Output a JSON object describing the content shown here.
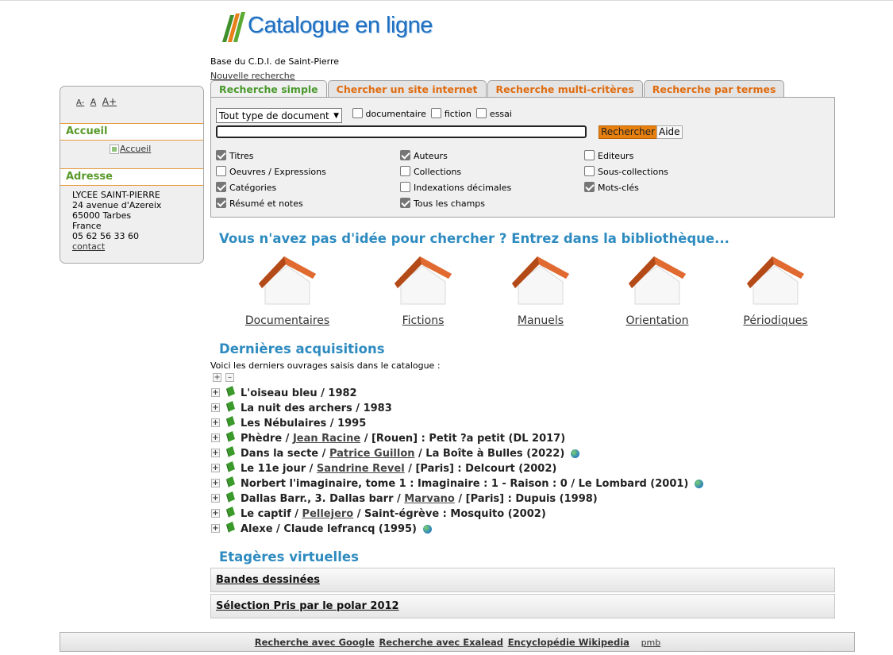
{
  "header": {
    "logo_text": "Catalogue en ligne",
    "base_name": "Base du C.D.I. de Saint-Pierre",
    "new_search": "Nouvelle recherche"
  },
  "sidebar": {
    "font_sizes": [
      "A-",
      "A",
      "A+"
    ],
    "accueil_title": "Accueil",
    "accueil_img_alt": "Accueil",
    "adresse_title": "Adresse",
    "address_lines": [
      "LYCEE SAINT-PIERRE",
      "24 avenue d'Azereix",
      "65000 Tarbes",
      "France",
      "05 62 56 33 60"
    ],
    "contact": "contact"
  },
  "tabs": [
    {
      "label": "Recherche simple",
      "active": true
    },
    {
      "label": "Chercher un site internet",
      "active": false
    },
    {
      "label": "Recherche multi-critères",
      "active": false
    },
    {
      "label": "Recherche par termes",
      "active": false
    }
  ],
  "search": {
    "doc_type_selected": "Tout type de document",
    "doc_types": [
      {
        "label": "documentaire",
        "checked": false
      },
      {
        "label": "fiction",
        "checked": false
      },
      {
        "label": "essai",
        "checked": false
      }
    ],
    "input_value": "",
    "submit_label": "Rechercher",
    "help_label": "Aide",
    "fields": [
      {
        "label": "Titres",
        "checked": true
      },
      {
        "label": "Auteurs",
        "checked": true
      },
      {
        "label": "Editeurs",
        "checked": false
      },
      {
        "label": "Oeuvres / Expressions",
        "checked": false
      },
      {
        "label": "Collections",
        "checked": false
      },
      {
        "label": "Sous-collections",
        "checked": false
      },
      {
        "label": "Catégories",
        "checked": true
      },
      {
        "label": "Indexations décimales",
        "checked": false
      },
      {
        "label": "Mots-clés",
        "checked": true
      },
      {
        "label": "Résumé et notes",
        "checked": true
      },
      {
        "label": "Tous les champs",
        "checked": true
      }
    ]
  },
  "library": {
    "title": "Vous n'avez pas d'idée pour chercher ? Entrez dans la bibliothèque...",
    "sections": [
      "Documentaires",
      "Fictions",
      "Manuels",
      "Orientation",
      "Périodiques"
    ]
  },
  "acquisitions": {
    "title": "Dernières acquisitions",
    "description": "Voici les derniers ouvrages saisis dans le catalogue :",
    "items": [
      {
        "before": "L'oiseau bleu / 1982",
        "author": "",
        "after": "",
        "globe": false
      },
      {
        "before": "La nuit des archers / 1983",
        "author": "",
        "after": "",
        "globe": false
      },
      {
        "before": "Les Nébulaires / 1995",
        "author": "",
        "after": "",
        "globe": false
      },
      {
        "before": "Phèdre / ",
        "author": "Jean Racine",
        "after": " / [Rouen] : Petit ?a petit (DL 2017)",
        "globe": false
      },
      {
        "before": "Dans la secte / ",
        "author": "Patrice Guillon",
        "after": " / La Boîte à Bulles (2022)",
        "globe": true
      },
      {
        "before": "Le 11e jour / ",
        "author": "Sandrine Revel",
        "after": " / [Paris] : Delcourt (2002)",
        "globe": false
      },
      {
        "before": "Norbert l'imaginaire, tome 1 : Imaginaire : 1 - Raison : 0 / Le Lombard (2001)",
        "author": "",
        "after": "",
        "globe": true
      },
      {
        "before": "Dallas Barr., 3. Dallas barr / ",
        "author": "Marvano",
        "after": " / [Paris] : Dupuis (1998)",
        "globe": false
      },
      {
        "before": "Le captif / ",
        "author": "Pellejero",
        "after": " / Saint-égrève : Mosquito (2002)",
        "globe": false
      },
      {
        "before": "Alexe / Claude lefrancq (1995)",
        "author": "",
        "after": "",
        "globe": true
      }
    ]
  },
  "shelves": {
    "title": "Etagères virtuelles",
    "items": [
      "Bandes dessinées",
      "Sélection Pris par le polar 2012"
    ]
  },
  "footer": {
    "links": [
      "Recherche avec Google",
      "Recherche avec Exalead",
      "Encyclopédie Wikipedia"
    ],
    "pmb": "pmb"
  },
  "colors": {
    "tab_active": "#4b9a2e",
    "tab_inactive": "#e06c10",
    "heading_blue": "#2e8bc0",
    "search_button": "#e8800f"
  }
}
